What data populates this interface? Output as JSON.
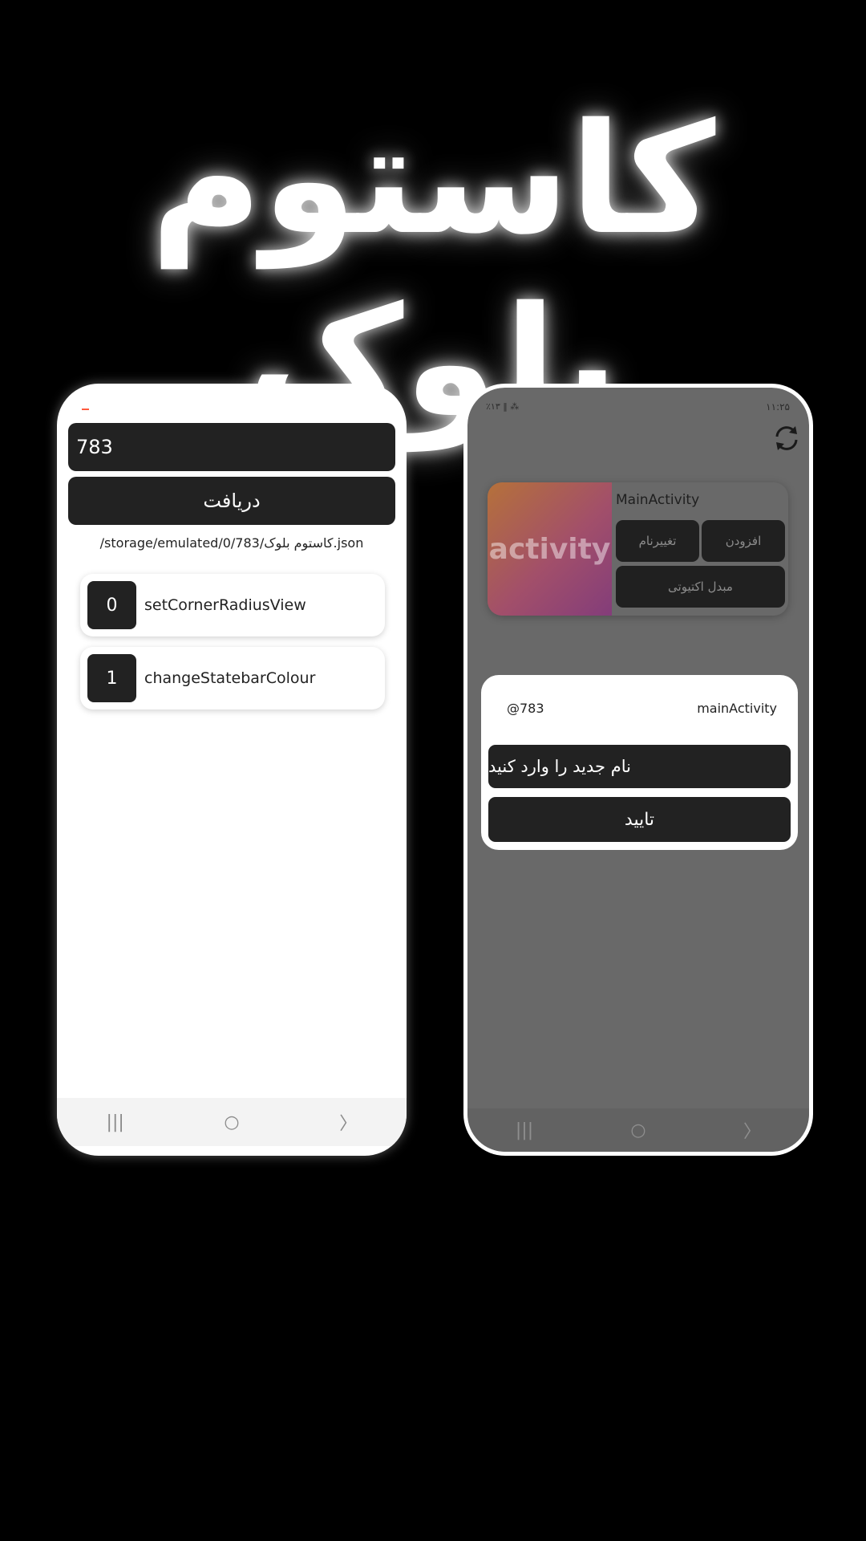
{
  "title": "کاستوم بلوک",
  "left_phone": {
    "id_input_value": "783",
    "receive_button": "دریافت",
    "path": "/storage/emulated/0/783/کاستوم بلوک.json",
    "blocks": [
      {
        "index": "0",
        "name": "setCornerRadiusView"
      },
      {
        "index": "1",
        "name": "changeStatebarColour"
      }
    ],
    "nav": {
      "recents": "|||",
      "home": "○",
      "back": "〉"
    }
  },
  "right_phone": {
    "status_left": "٪۱۳ ‖ ⁂",
    "status_right": "۱۱:۲۵",
    "card": {
      "image_text": "activity",
      "title": "MainActivity",
      "add_button": "افزودن",
      "rename_button": "تغییرنام",
      "converter_button": "مبدل اکتیوتی"
    },
    "dialog": {
      "handle": "@783",
      "name": "mainActivity",
      "new_name_input": "نام جدید را وارد کنید",
      "confirm_button": "تایید"
    },
    "nav": {
      "recents": "|||",
      "home": "○",
      "back": "〉"
    }
  }
}
